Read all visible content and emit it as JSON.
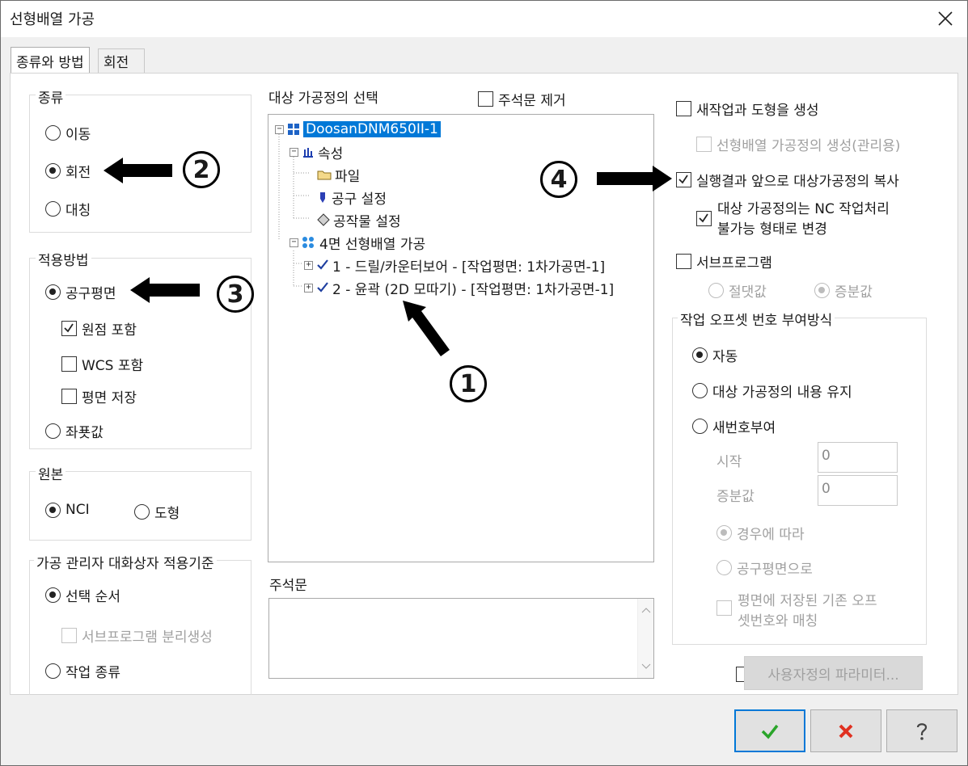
{
  "window": {
    "title": "선형배열 가공"
  },
  "tabs": [
    {
      "label": "종류와 방법"
    },
    {
      "label": "회전"
    }
  ],
  "type_group": {
    "label": "종류",
    "options": [
      "이동",
      "회전",
      "대칭"
    ],
    "selected": "회전"
  },
  "method_group": {
    "label": "적용방법",
    "radio_tool_plane": "공구평면",
    "chk_origin": "원점 포함",
    "chk_wcs": "WCS 포함",
    "chk_save_plane": "평면 저장",
    "radio_coord": "좌푯값"
  },
  "source_group": {
    "label": "원본",
    "nci": "NCI",
    "geometry": "도형"
  },
  "manager_group": {
    "label": "가공 관리자 대화상자 적용기준",
    "select_order": "선택 순서",
    "subprogram_split": "서브프로그램 분리생성",
    "op_type": "작업 종류"
  },
  "tree": {
    "label": "대상 가공정의 선택",
    "remove_comments": "주석문 제거",
    "root": "DoosanDNM650II-1",
    "properties": "속성",
    "file": "파일",
    "tool_settings": "공구 설정",
    "stock_settings": "공작물 설정",
    "group": "4면 선형배열 가공",
    "op1": "1 - 드릴/카운터보어 - [작업평면: 1차가공면-1]",
    "op2": "2 - 윤곽 (2D 모따기) - [작업평면: 1차가공면-1]"
  },
  "comment": {
    "label": "주석문"
  },
  "right": {
    "new_op_geometry": "새작업과 도형을 생성",
    "create_array_op": "선형배열 가공정의 생성(관리용)",
    "copy_ops": "실행결과 앞으로 대상가공정의 복사",
    "disable_nc_line1": "대상 가공정의는 NC 작업처리",
    "disable_nc_line2": "불가능 형태로 변경",
    "subprogram": "서브프로그램",
    "absolute": "절댓값",
    "incremental": "증분값"
  },
  "offset_group": {
    "label": "작업 오프셋 번호 부여방식",
    "auto": "자동",
    "keep": "대상 가공정의 내용 유지",
    "renumber": "새번호부여",
    "start_label": "시작",
    "start_value": "0",
    "inc_label": "증분값",
    "inc_value": "0",
    "by_case": "경우에 따라",
    "by_tool_plane": "공구평면으로",
    "match_line1": "평면에 저장된 기존 오프",
    "match_line2": "셋번호와 매칭"
  },
  "custom_params_button": "사용자정의 파라미터...",
  "callouts": {
    "c1": "1",
    "c2": "2",
    "c3": "3",
    "c4": "4"
  },
  "icons": {
    "ok": "check-icon",
    "cancel": "x-icon",
    "help": "question-icon"
  },
  "colors": {
    "selection": "#0078d7",
    "ok_green": "#2aa52a",
    "cancel_red": "#e03020"
  }
}
